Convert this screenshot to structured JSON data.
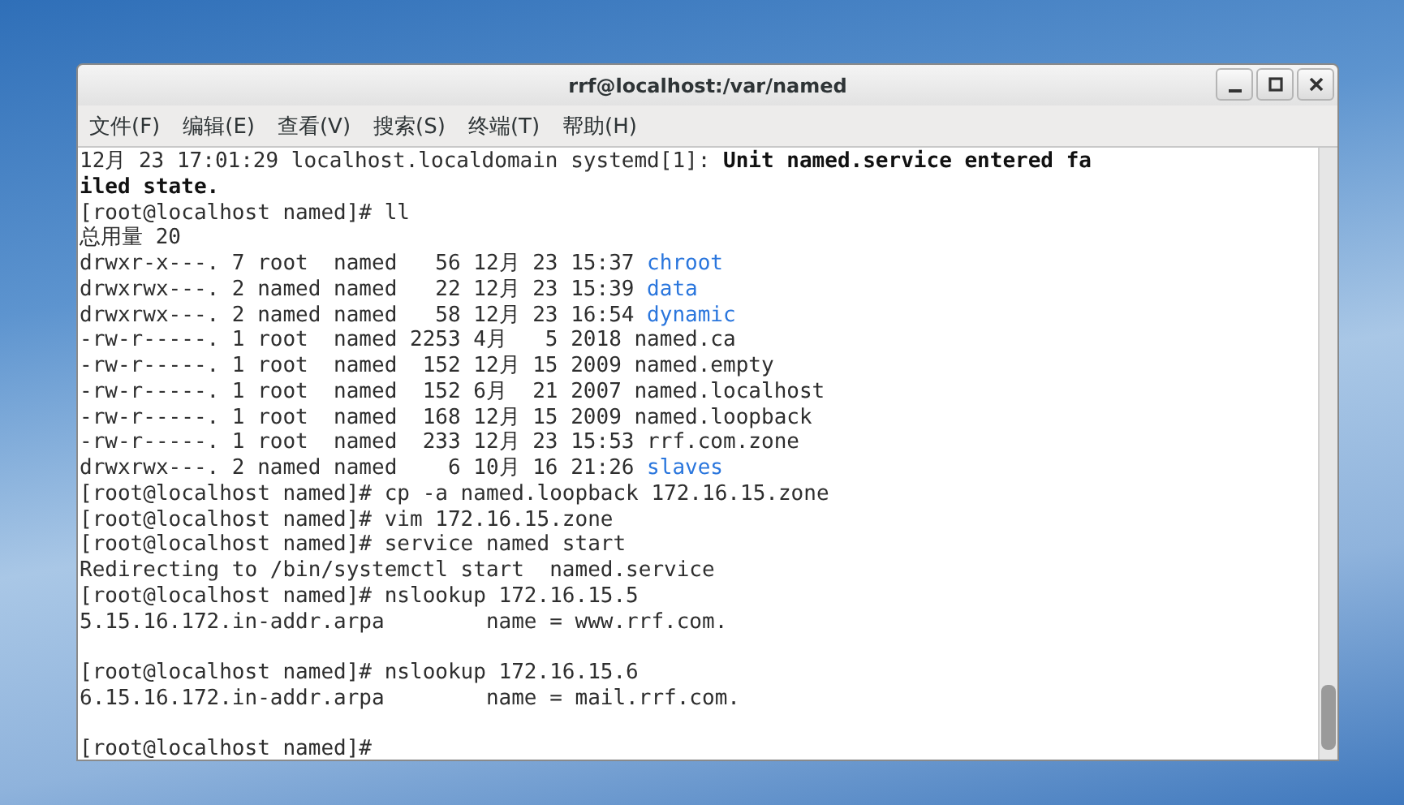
{
  "window": {
    "title": "rrf@localhost:/var/named"
  },
  "menu": [
    "文件(F)",
    "编辑(E)",
    "查看(V)",
    "搜索(S)",
    "终端(T)",
    "帮助(H)"
  ],
  "terminal": {
    "lines": [
      {
        "kind": "output",
        "segments": [
          {
            "kind": "text",
            "text": "12月 23 17:01:29 localhost.localdomain systemd[1]: "
          },
          {
            "kind": "bold",
            "text": "Unit named.service entered fa"
          }
        ]
      },
      {
        "kind": "output",
        "segments": [
          {
            "kind": "bold",
            "text": "iled state."
          }
        ]
      },
      {
        "kind": "output",
        "segments": [
          {
            "kind": "text",
            "text": "[root@localhost named]# ll"
          }
        ]
      },
      {
        "kind": "output",
        "segments": [
          {
            "kind": "text",
            "text": "总用量 20"
          }
        ]
      },
      {
        "kind": "output",
        "segments": [
          {
            "kind": "text",
            "text": "drwxr-x---. 7 root  named   56 12月 23 15:37 "
          },
          {
            "kind": "dir",
            "text": "chroot"
          }
        ]
      },
      {
        "kind": "output",
        "segments": [
          {
            "kind": "text",
            "text": "drwxrwx---. 2 named named   22 12月 23 15:39 "
          },
          {
            "kind": "dir",
            "text": "data"
          }
        ]
      },
      {
        "kind": "output",
        "segments": [
          {
            "kind": "text",
            "text": "drwxrwx---. 2 named named   58 12月 23 16:54 "
          },
          {
            "kind": "dir",
            "text": "dynamic"
          }
        ]
      },
      {
        "kind": "output",
        "segments": [
          {
            "kind": "text",
            "text": "-rw-r-----. 1 root  named 2253 4月   5 2018 named.ca"
          }
        ]
      },
      {
        "kind": "output",
        "segments": [
          {
            "kind": "text",
            "text": "-rw-r-----. 1 root  named  152 12月 15 2009 named.empty"
          }
        ]
      },
      {
        "kind": "output",
        "segments": [
          {
            "kind": "text",
            "text": "-rw-r-----. 1 root  named  152 6月  21 2007 named.localhost"
          }
        ]
      },
      {
        "kind": "output",
        "segments": [
          {
            "kind": "text",
            "text": "-rw-r-----. 1 root  named  168 12月 15 2009 named.loopback"
          }
        ]
      },
      {
        "kind": "output",
        "segments": [
          {
            "kind": "text",
            "text": "-rw-r-----. 1 root  named  233 12月 23 15:53 rrf.com.zone"
          }
        ]
      },
      {
        "kind": "output",
        "segments": [
          {
            "kind": "text",
            "text": "drwxrwx---. 2 named named    6 10月 16 21:26 "
          },
          {
            "kind": "dir",
            "text": "slaves"
          }
        ]
      },
      {
        "kind": "output",
        "segments": [
          {
            "kind": "text",
            "text": "[root@localhost named]# cp -a named.loopback 172.16.15.zone"
          }
        ]
      },
      {
        "kind": "output",
        "segments": [
          {
            "kind": "text",
            "text": "[root@localhost named]# vim 172.16.15.zone"
          }
        ]
      },
      {
        "kind": "output",
        "segments": [
          {
            "kind": "text",
            "text": "[root@localhost named]# service named start"
          }
        ]
      },
      {
        "kind": "output",
        "segments": [
          {
            "kind": "text",
            "text": "Redirecting to /bin/systemctl start  named.service"
          }
        ]
      },
      {
        "kind": "output",
        "segments": [
          {
            "kind": "text",
            "text": "[root@localhost named]# nslookup 172.16.15.5"
          }
        ]
      },
      {
        "kind": "output",
        "segments": [
          {
            "kind": "text",
            "text": "5.15.16.172.in-addr.arpa        name = www.rrf.com."
          }
        ]
      },
      {
        "kind": "blank"
      },
      {
        "kind": "output",
        "segments": [
          {
            "kind": "text",
            "text": "[root@localhost named]# nslookup 172.16.15.6"
          }
        ]
      },
      {
        "kind": "output",
        "segments": [
          {
            "kind": "text",
            "text": "6.15.16.172.in-addr.arpa        name = mail.rrf.com."
          }
        ]
      },
      {
        "kind": "blank"
      },
      {
        "kind": "output",
        "segments": [
          {
            "kind": "text",
            "text": "[root@localhost named]# "
          }
        ]
      }
    ]
  }
}
